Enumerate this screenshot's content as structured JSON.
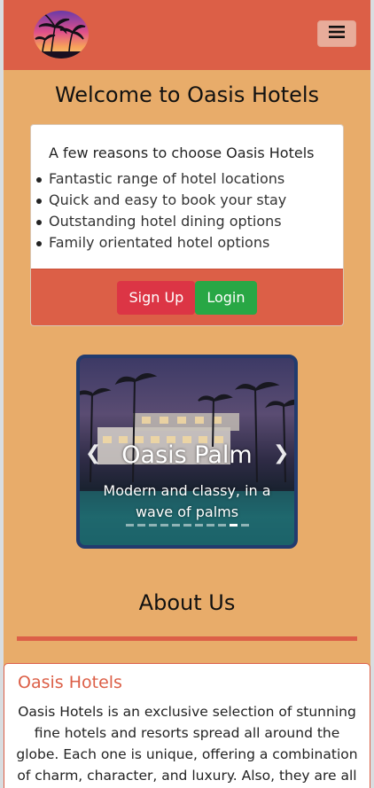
{
  "navbar": {
    "logo_icon": "palm-tree-sunset-logo",
    "toggler_icon": "hamburger-menu-icon"
  },
  "main": {
    "title": "Welcome to Oasis Hotels",
    "reasons": {
      "heading": "A few reasons to choose Oasis Hotels",
      "items": [
        "Fantastic range of hotel locations",
        "Quick and easy to book your stay",
        "Outstanding hotel dining options",
        "Family orientated hotel options"
      ],
      "signup_label": "Sign Up",
      "login_label": "Login"
    }
  },
  "carousel": {
    "slide_title": "Oasis Palm",
    "slide_caption": "Modern and classy, in a wave of palms",
    "prev_icon": "chevron-left-icon",
    "next_icon": "chevron-right-icon",
    "indicator_count": 11,
    "active_index": 9
  },
  "about": {
    "title": "About Us",
    "card_title": "Oasis Hotels",
    "card_text": "Oasis Hotels is an exclusive selection of stunning fine hotels and resorts spread all around the globe. Each one is unique, offering a combination of charm, character, and luxury. Also, they are all in"
  },
  "colors": {
    "page_bg": "#e8ac6a",
    "brand": "#dc5f47",
    "signup": "#dc3545",
    "login": "#28a745",
    "carousel_border": "#223b6e"
  }
}
